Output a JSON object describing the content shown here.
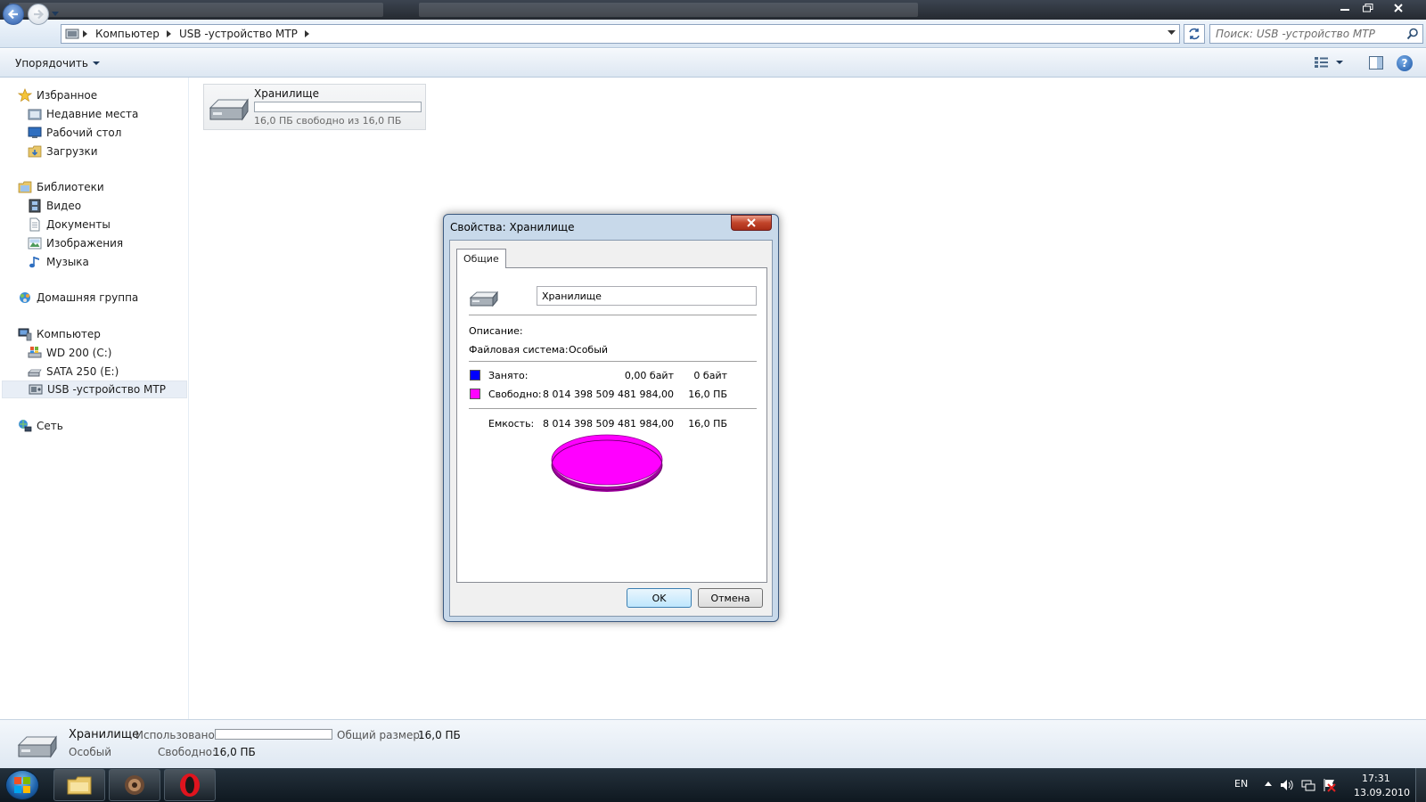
{
  "address": {
    "crumbs": [
      "Компьютер",
      "USB -устройство МТР"
    ]
  },
  "search": {
    "placeholder": "Поиск: USB -устройство МТР"
  },
  "toolbar": {
    "organize_label": "Упорядочить",
    "help_label": "?"
  },
  "sidebar": {
    "favorites": "Избранное",
    "recent": "Недавние места",
    "desktop": "Рабочий стол",
    "downloads": "Загрузки",
    "libraries": "Библиотеки",
    "video": "Видео",
    "documents": "Документы",
    "images": "Изображения",
    "music": "Музыка",
    "homegroup": "Домашняя группа",
    "computer": "Компьютер",
    "drive_c": "WD 200 (C:)",
    "drive_e": "SATA 250 (E:)",
    "usb_mtp": "USB -устройство МТР",
    "network": "Сеть"
  },
  "tile": {
    "name": "Хранилище",
    "space": "16,0 ПБ свободно из 16,0 ПБ",
    "used_fraction": 0
  },
  "dialog": {
    "title": "Свойства: Хранилище",
    "tab": "Общие",
    "name_value": "Хранилище",
    "description_label": "Описание:",
    "fs_label": "Файловая система:",
    "fs_value": "Особый",
    "used_label": "Занято:",
    "used_bytes": "0,00 байт",
    "used_short": "0 байт",
    "free_label": "Свободно:",
    "free_bytes": "8 014 398 509 481 984,00",
    "free_short": "16,0 ПБ",
    "capacity_label": "Емкость:",
    "capacity_bytes": "8 014 398 509 481 984,00",
    "capacity_short": "16,0 ПБ",
    "ok": "OK",
    "cancel": "Отмена",
    "used_color": "#0000ff",
    "free_color": "#ff00ff"
  },
  "details": {
    "name": "Хранилище",
    "fs": "Особый",
    "used_label": "Использовано:",
    "total_label": "Общий размер:",
    "total_value": "16,0 ПБ",
    "free_label": "Свободно:",
    "free_value": "16,0 ПБ"
  },
  "taskbar": {
    "lang": "EN",
    "time": "17:31",
    "date": "13.09.2010"
  }
}
